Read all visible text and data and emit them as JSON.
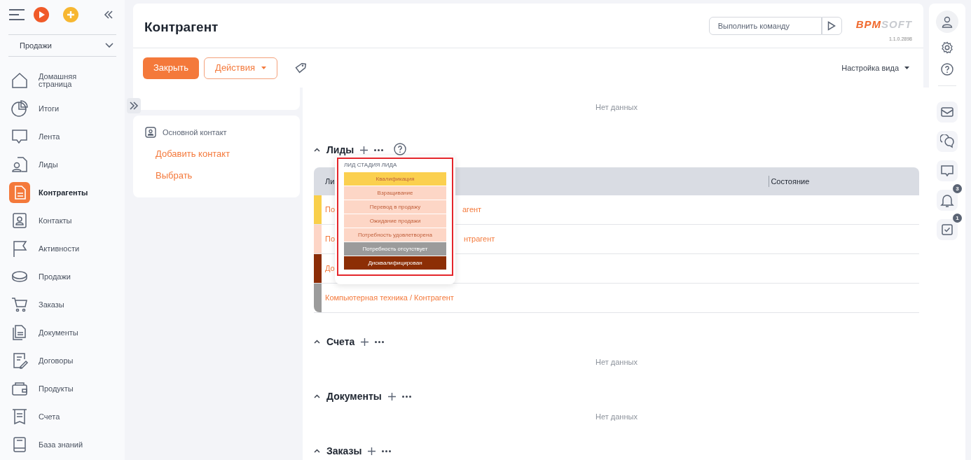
{
  "sidebar": {
    "section_select": "Продажи",
    "items": [
      {
        "label": "Домашняя страница",
        "selected": false
      },
      {
        "label": "Итоги",
        "selected": false
      },
      {
        "label": "Лента",
        "selected": false
      },
      {
        "label": "Лиды",
        "selected": false
      },
      {
        "label": "Контрагенты",
        "selected": true
      },
      {
        "label": "Контакты",
        "selected": false
      },
      {
        "label": "Активности",
        "selected": false
      },
      {
        "label": "Продажи",
        "selected": false
      },
      {
        "label": "Заказы",
        "selected": false
      },
      {
        "label": "Документы",
        "selected": false
      },
      {
        "label": "Договоры",
        "selected": false
      },
      {
        "label": "Продукты",
        "selected": false
      },
      {
        "label": "Счета",
        "selected": false
      },
      {
        "label": "База знаний",
        "selected": false
      }
    ]
  },
  "header": {
    "title": "Контрагент",
    "command_placeholder": "Выполнить команду",
    "logo_accent": "BPM",
    "logo_rest": "SOFT",
    "version": "1.1.0.2898"
  },
  "toolbar": {
    "buttons": [
      {
        "label": "Закрыть",
        "kind": "primary"
      },
      {
        "label": "Действия",
        "kind": "dropdown"
      }
    ],
    "view_settings": "Настройка вида"
  },
  "contact_panel": {
    "title": "Основной контакт",
    "links": [
      "Добавить контакт",
      "Выбрать"
    ]
  },
  "details": [
    {
      "kind": "cut",
      "empty_text": "Нет данных"
    },
    {
      "kind": "table",
      "title": "Лиды",
      "columns": [
        "Ли",
        "Состояние"
      ],
      "rows": [
        {
          "color": "#f9cf4a",
          "text_left": "По",
          "text_right": "агент"
        },
        {
          "color": "#fdd5c6",
          "text_left": "По",
          "text_right": "нтрагент"
        },
        {
          "color": "#8b2c06",
          "text_left": "До"
        },
        {
          "color": "#9b9b9b",
          "text_left": "Компьютерная техника / Контрагент"
        }
      ]
    },
    {
      "kind": "empty",
      "title": "Счета",
      "empty_text": "Нет данных"
    },
    {
      "kind": "empty",
      "title": "Документы",
      "empty_text": "Нет данных"
    },
    {
      "kind": "header_only",
      "title": "Заказы"
    }
  ],
  "stage_popup": {
    "title": "ЛИД СТАДИЯ ЛИДА",
    "stages": [
      {
        "label": "Квалификация",
        "color": "#fbd04f"
      },
      {
        "label": "Взращивание",
        "color": "#fdd6c6"
      },
      {
        "label": "Перевод в продажу",
        "color": "#fdd6c6"
      },
      {
        "label": "Ожидание продажи",
        "color": "#fdd6c6"
      },
      {
        "label": "Потребность удовлетворена",
        "color": "#fdd6c6"
      },
      {
        "label": "Потребность отсутствует",
        "color": "#9b9b9b"
      },
      {
        "label": "Дисквалифицирован",
        "color": "#8c2e05"
      }
    ]
  },
  "right_rail": {
    "notifications_badge": "3",
    "tasks_badge": "1"
  }
}
